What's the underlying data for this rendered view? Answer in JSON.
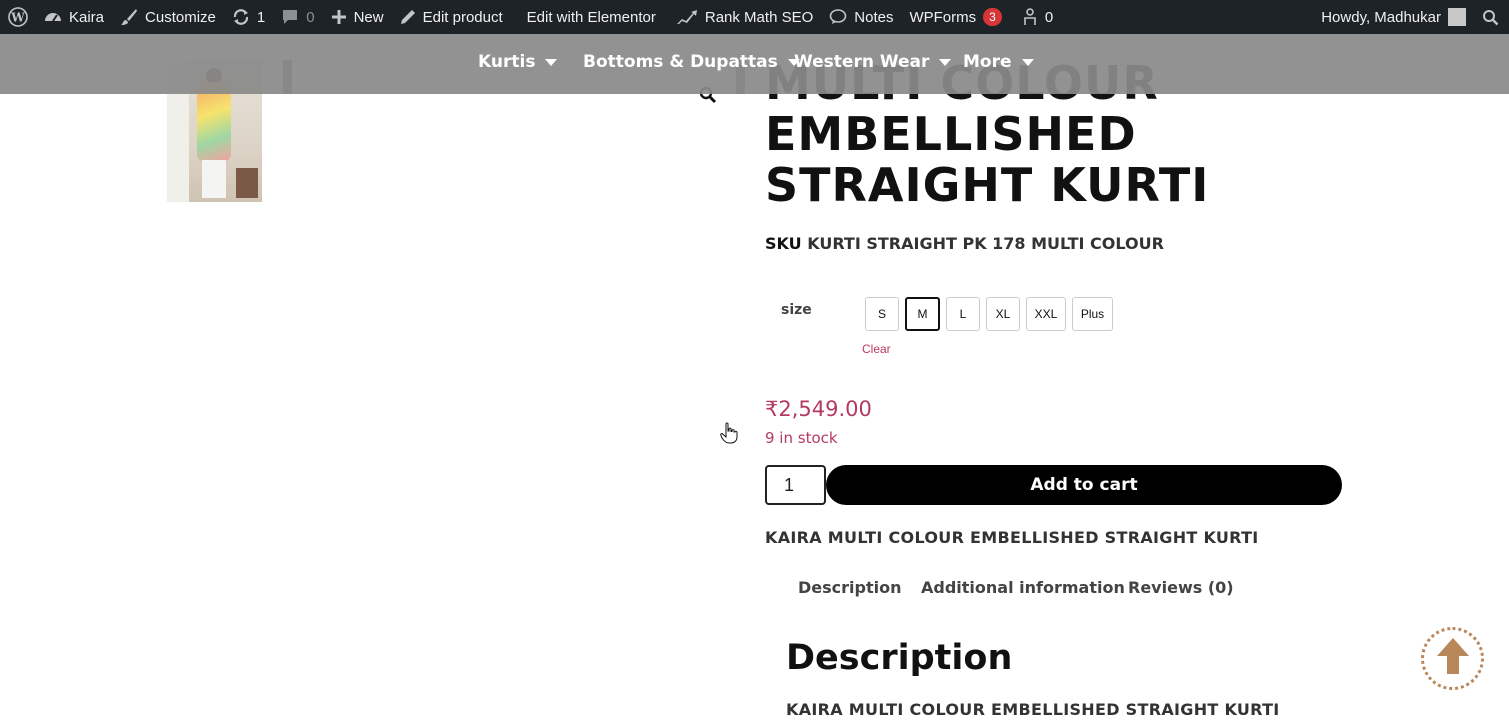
{
  "adminbar": {
    "wp_logo_icon": "wordpress-icon",
    "site_name": "Kaira",
    "customize": "Customize",
    "updates_count": "1",
    "comments_count": "0",
    "new_label": "New",
    "edit_product": "Edit product",
    "edit_elementor": "Edit with Elementor",
    "rank_math": "Rank Math SEO",
    "notes": "Notes",
    "wpforms": "WPForms",
    "wpforms_badge": "3",
    "ab_counter": "0",
    "howdy": "Howdy, Madhukar"
  },
  "nav": {
    "items": [
      {
        "label": "Kurtis"
      },
      {
        "label": "Bottoms & Dupattas"
      },
      {
        "label": "Western Wear"
      },
      {
        "label": "More"
      }
    ]
  },
  "product": {
    "title": "MULTI COLOUR EMBELLISHED STRAIGHT KURTI",
    "sku_label": "SKU",
    "sku_value": "KURTI STRAIGHT PK 178 MULTI COLOUR",
    "size_label": "size",
    "sizes": [
      "S",
      "M",
      "L",
      "XL",
      "XXL",
      "Plus"
    ],
    "selected_size": "M",
    "clear_label": "Clear",
    "price": "₹2,549.00",
    "stock": "9 in stock",
    "quantity": "1",
    "add_to_cart": "Add to cart",
    "short_description": "KAIRA MULTI COLOUR EMBELLISHED STRAIGHT KURTI"
  },
  "tabs": {
    "description": "Description",
    "additional": "Additional information",
    "reviews": "Reviews (0)"
  },
  "description": {
    "heading": "Description",
    "text": "KAIRA MULTI COLOUR EMBELLISHED STRAIGHT KURTI"
  },
  "colors": {
    "adminbar_bg": "#1d2327",
    "price_color": "#b53a63",
    "button_bg": "#000000",
    "totop_color": "#b8875a"
  }
}
